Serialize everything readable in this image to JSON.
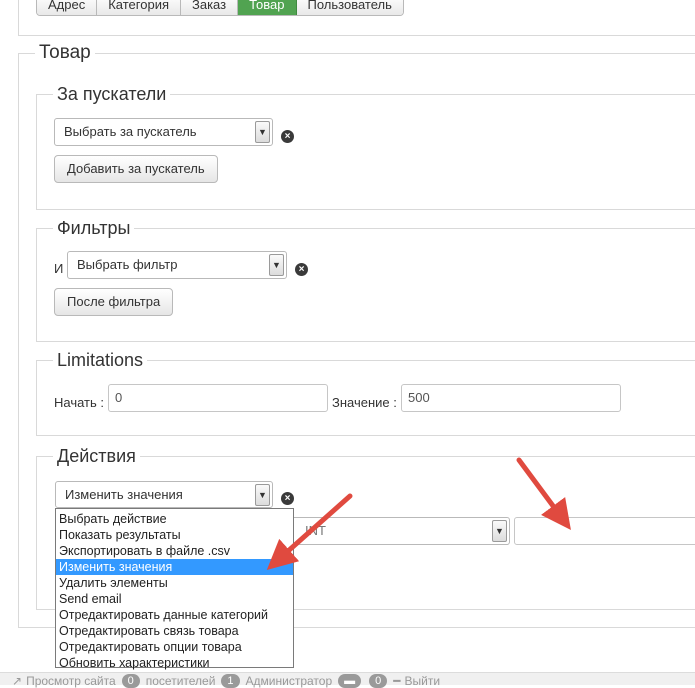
{
  "tabs": [
    "Адрес",
    "Категория",
    "Заказ",
    "Товар",
    "Пользователь"
  ],
  "active_tab": "Товар",
  "main_legend": "Товар",
  "triggers": {
    "legend": "За пускатели",
    "select_value": "Выбрать за пускатель",
    "add_button": "Добавить за пускатель"
  },
  "filters": {
    "legend": "Фильтры",
    "prefix": "И",
    "select_value": "Выбрать фильтр",
    "after_button": "После фильтра"
  },
  "limitations": {
    "legend": "Limitations",
    "start_label": "Начать :",
    "start_value": "0",
    "value_label": "Значение :",
    "value_value": "500"
  },
  "actions": {
    "legend": "Действия",
    "select_value": "Изменить значения",
    "hidden_select_fragment": "INT",
    "options": [
      "Выбрать действие",
      "Показать результаты",
      "Экспортировать в файле .csv",
      "Изменить значения",
      "Удалить элементы",
      "Send email",
      "Отредактировать данные категорий",
      "Отредактировать связь товара",
      "Отредактировать опции товара",
      "Обновить характеристики"
    ],
    "highlighted_index": 3
  },
  "footer": {
    "view_site": "Просмотр сайта",
    "visitors_count": "0",
    "visitors_label": "посетителей",
    "admins_count": "1",
    "admins_label": "Администратор",
    "messages_count": "0",
    "logout": "Выйти"
  },
  "colors": {
    "active_tab": "#51a351",
    "highlight": "#3399ff",
    "arrow": "#e04a3f"
  }
}
